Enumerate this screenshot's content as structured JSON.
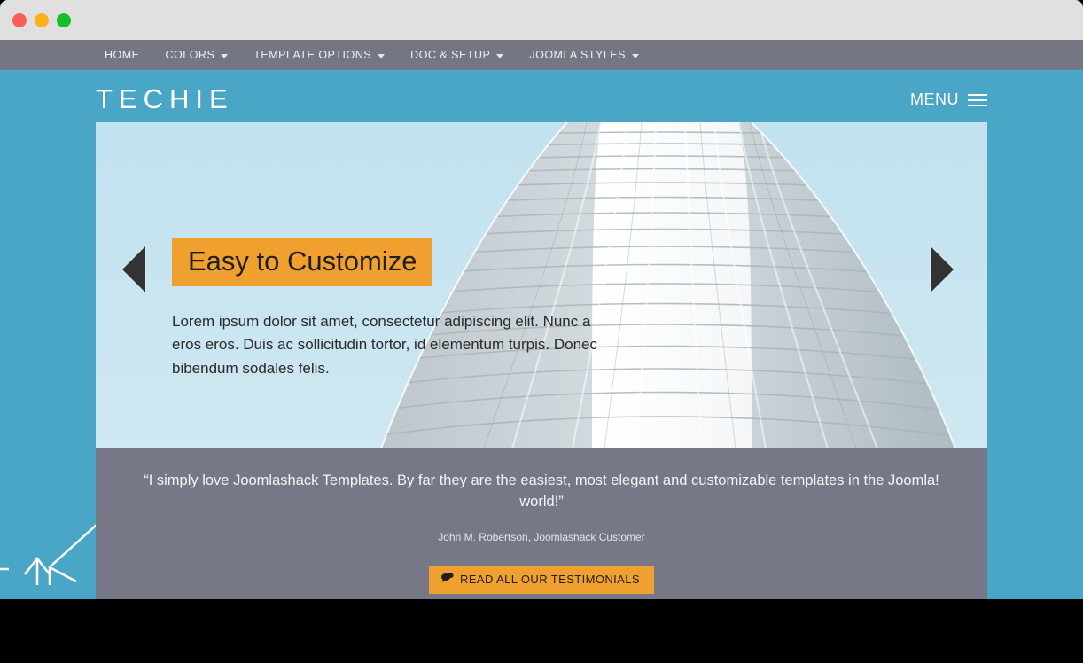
{
  "window": {
    "traffic_lights": [
      {
        "name": "close",
        "color": "#fa5e54"
      },
      {
        "name": "minimize",
        "color": "#fdb01c"
      },
      {
        "name": "maximize",
        "color": "#18be2a"
      }
    ]
  },
  "topnav": {
    "background": "#757684",
    "items": [
      {
        "label": "HOME",
        "has_caret": false
      },
      {
        "label": "COLORS",
        "has_caret": true
      },
      {
        "label": "TEMPLATE OPTIONS",
        "has_caret": true
      },
      {
        "label": "DOC & SETUP",
        "has_caret": true
      },
      {
        "label": "JOOMLA STYLES",
        "has_caret": true
      }
    ]
  },
  "header": {
    "logo": "TECHIE",
    "menu_label": "MENU",
    "menu_icon": "hamburger-icon",
    "background": "#49a6c6"
  },
  "slider": {
    "prev_icon": "chevron-left-icon",
    "next_icon": "chevron-right-icon",
    "slide": {
      "title": "Easy to Customize",
      "title_background": "#f0a02e",
      "text": "Lorem ipsum dolor sit amet, consectetur adipiscing elit. Nunc a eros eros. Duis ac sollicitudin tortor, id elementum turpis. Donec bibendum sodales felis."
    }
  },
  "testimonial": {
    "background": "#767787",
    "quote": "“I simply love Joomlashack Templates. By far they are the easiest, most elegant and customizable templates in the Joomla! world!”",
    "author": "John M. Robertson, Joomlashack Customer",
    "button": {
      "label": "READ ALL OUR TESTIMONIALS",
      "icon": "chat-bubble-icon",
      "color": "#f0a02e"
    }
  }
}
